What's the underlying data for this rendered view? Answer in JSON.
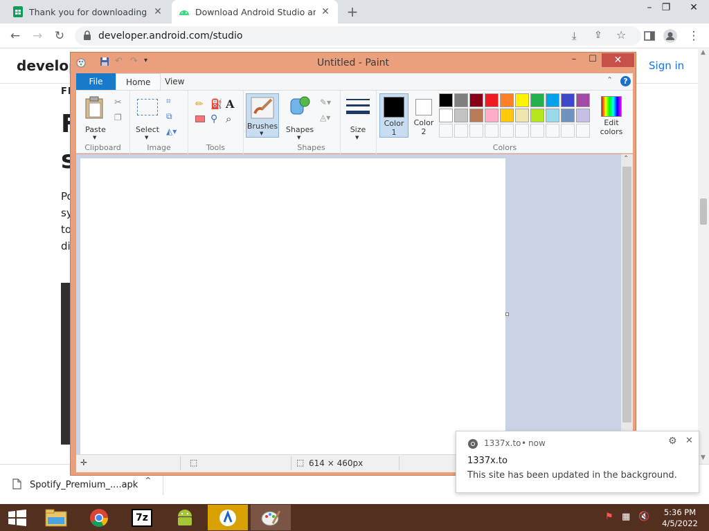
{
  "browser": {
    "tabs": [
      {
        "title": "Thank you for downloading APK",
        "favicon": "sheets-icon"
      },
      {
        "title": "Download Android Studio and SI",
        "favicon": "android-icon"
      }
    ],
    "url": "developer.android.com/studio"
  },
  "page": {
    "brand": "develope",
    "sign_in": "Sign in",
    "eyebrow": "FE",
    "heading_1": "F",
    "heading_2": "s",
    "lines": [
      "Po",
      "sy",
      "to",
      "di"
    ]
  },
  "paint": {
    "title": "Untitled - Paint",
    "tabs": {
      "file": "File",
      "home": "Home",
      "view": "View"
    },
    "groups": {
      "clipboard": "Clipboard",
      "image": "Image",
      "tools": "Tools",
      "shapes": "Shapes",
      "colors": "Colors"
    },
    "buttons": {
      "paste": "Paste",
      "select": "Select",
      "brushes": "Brushes",
      "shapes": "Shapes",
      "size": "Size",
      "color1": "Color\n1",
      "color2": "Color\n2",
      "edit_colors": "Edit\ncolors"
    },
    "palette_row1": [
      "#000000",
      "#7f7f7f",
      "#880015",
      "#ed1c24",
      "#ff7f27",
      "#fff200",
      "#22b14c",
      "#00a2e8",
      "#3f48cc",
      "#a349a4"
    ],
    "palette_row2": [
      "#ffffff",
      "#c3c3c3",
      "#b97a57",
      "#ffaec9",
      "#ffc90e",
      "#efe4b0",
      "#b5e61d",
      "#99d9ea",
      "#7092be",
      "#c8bfe7"
    ],
    "status_size": "614 × 460px"
  },
  "downloads": {
    "file": "Spotify_Premium_....apk"
  },
  "notification": {
    "source": "1337x.to",
    "time": "now",
    "title": "1337x.to",
    "body": "This site has been updated in the background."
  },
  "taskbar": {
    "time": "5:36 PM",
    "date": "4/5/2022"
  }
}
